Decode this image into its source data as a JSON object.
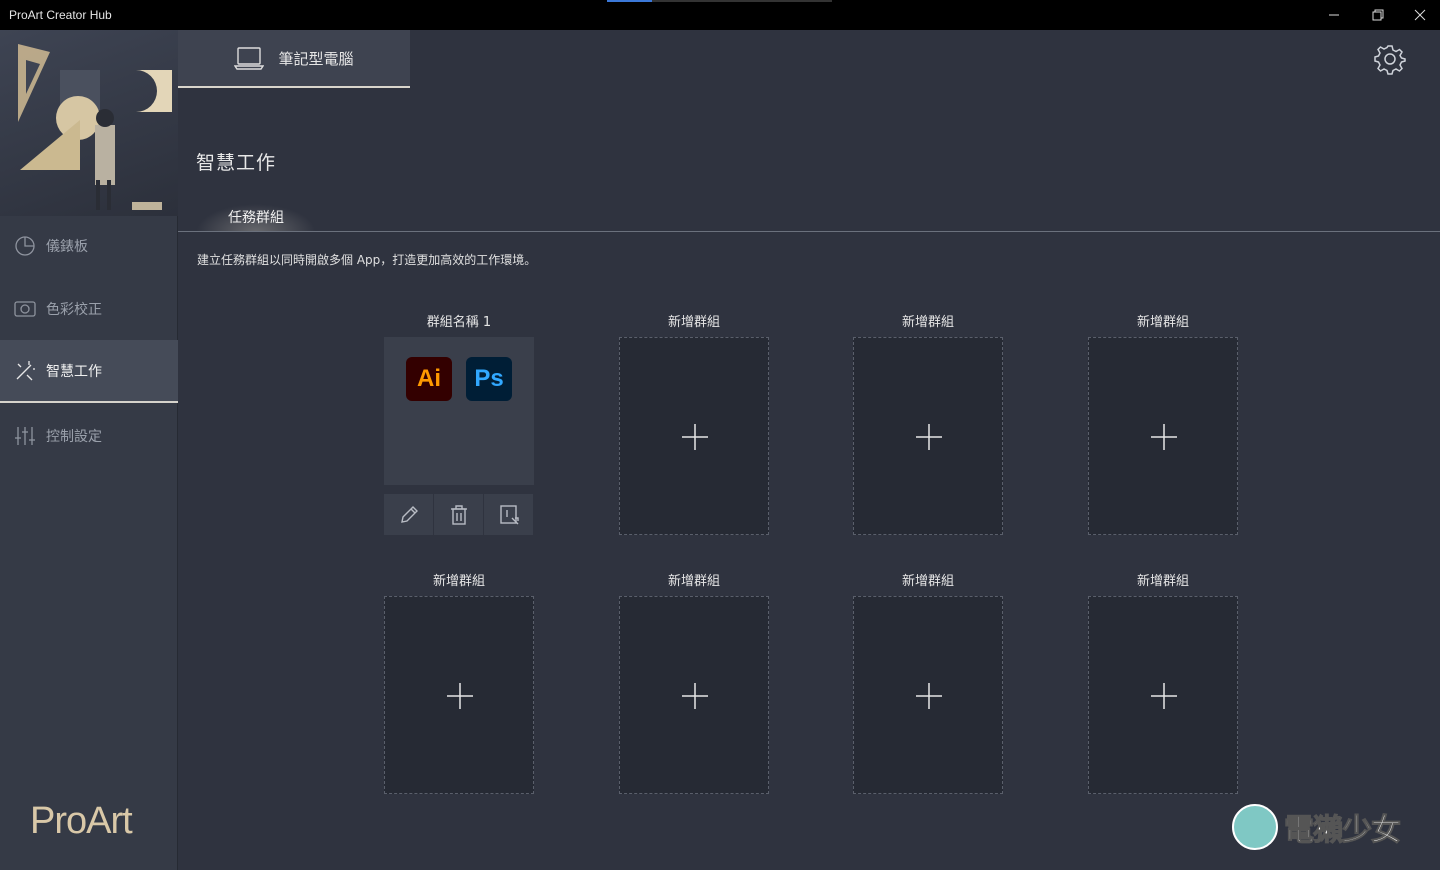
{
  "window": {
    "title": "ProArt Creator Hub",
    "progress_fraction": 0.2
  },
  "sidebar": {
    "items": [
      {
        "label": "儀錶板",
        "icon": "dashboard-pie-icon"
      },
      {
        "label": "色彩校正",
        "icon": "color-calibration-icon"
      },
      {
        "label": "智慧工作",
        "icon": "magic-wand-icon",
        "active": true
      },
      {
        "label": "控制設定",
        "icon": "sliders-icon"
      }
    ],
    "brand": "ProArt"
  },
  "device_tab": {
    "label": "筆記型電腦",
    "icon": "laptop-icon"
  },
  "header": {
    "settings_icon": "gear-icon"
  },
  "main": {
    "title": "智慧工作",
    "subtab": "任務群組",
    "description": "建立任務群組以同時開啟多個 App，打造更加高效的工作環境。",
    "groups": [
      {
        "label": "群組名稱 1",
        "apps": [
          "Ai",
          "Ps"
        ],
        "actions": [
          "edit-icon",
          "delete-icon",
          "launch-icon"
        ]
      },
      {
        "label": "新增群組"
      },
      {
        "label": "新增群組"
      },
      {
        "label": "新增群組"
      },
      {
        "label": "新增群組"
      },
      {
        "label": "新增群組"
      },
      {
        "label": "新增群組"
      },
      {
        "label": "新增群組"
      }
    ]
  },
  "watermark": {
    "text": "電獺少女"
  },
  "colors": {
    "accent_gold": "#d9c8a8",
    "ai_orange": "#ff9a00",
    "ps_blue": "#31a8ff"
  }
}
